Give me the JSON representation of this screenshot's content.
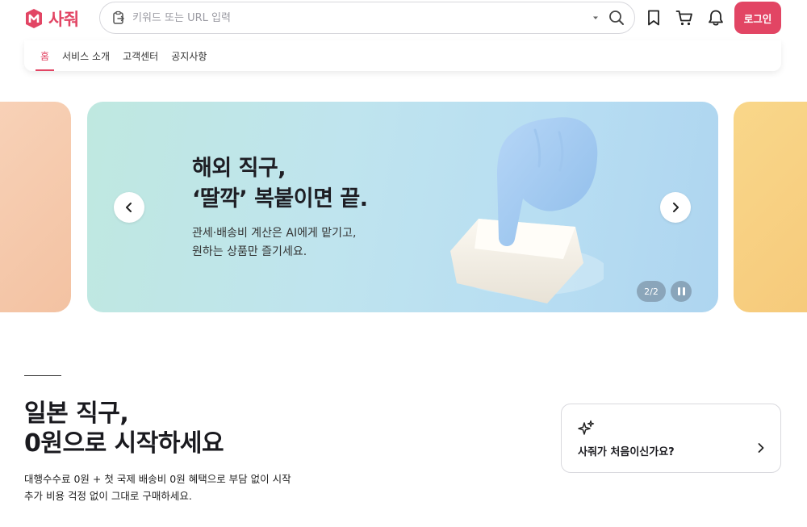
{
  "header": {
    "brand": "사줘",
    "search_placeholder": "키워드 또는 URL 입력",
    "login_label": "로그인",
    "accent": "#e24564"
  },
  "nav": {
    "items": [
      {
        "label": "홈",
        "active": true
      },
      {
        "label": "서비스 소개",
        "active": false
      },
      {
        "label": "고객센터",
        "active": false
      },
      {
        "label": "공지사항",
        "active": false
      }
    ]
  },
  "banner": {
    "title_line1": "해외 직구,",
    "title_line2": "‘딸깍’ 복붙이면 끝.",
    "subtitle_line1": "관세·배송비 계산은 AI에게 맡기고,",
    "subtitle_line2": "원하는 상품만 즐기세요.",
    "counter": "2/2"
  },
  "intro": {
    "title_line1": "일본 직구,",
    "title_line2": "0원으로 시작하세요",
    "desc_line1": "대행수수료 0원 + 첫 국제 배송비 0원 혜택으로 부담 없이 시작",
    "desc_line2": "추가 비용 걱정 없이 그대로 구매하세요."
  },
  "card": {
    "label": "사줘가 처음이신가요?"
  }
}
